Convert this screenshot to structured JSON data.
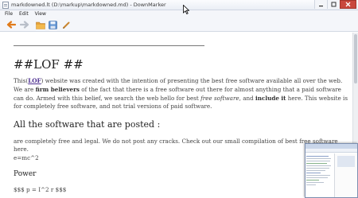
{
  "window": {
    "title": "markdowned.lt (D:\\markup\\markdowned.md) - DownMarker"
  },
  "menu": {
    "items": [
      "File",
      "Edit",
      "View"
    ]
  },
  "toolbar": {
    "buttons": [
      {
        "name": "back",
        "icon": "arrow-left-icon",
        "color": "#e07b1a"
      },
      {
        "name": "forward",
        "icon": "arrow-right-icon",
        "color": "#b9bfc9"
      },
      {
        "name": "open",
        "icon": "folder-icon",
        "color": "#e6a43a"
      },
      {
        "name": "save",
        "icon": "save-icon",
        "color": "#5a8fd0"
      },
      {
        "name": "edit",
        "icon": "pencil-icon",
        "color": "#c9862f"
      }
    ]
  },
  "document": {
    "heading1": "##LOF ##",
    "para_prefix": "This(",
    "para_link": "LOF",
    "para_part1": ") website was created with the intention of presenting the best free software available all over the web. We are ",
    "para_bold1": "firm believers",
    "para_part2": " of the fact that there is a free software out there for almost anything that a paid software can do. Armed with this belief, we search the web hello for best ",
    "para_italic": "free software",
    "para_part3": ", and ",
    "para_bold2": "include it",
    "para_part4": " here. This website is for completely free software, and not trial versions of paid software.",
    "heading2": "All the software that are posted :",
    "para2": "are completely free and legal. We do not post any cracks. Check out our small compilation of best free software here.",
    "formula1": "e=mc^2",
    "heading3": "Power",
    "formula2": "$$$ p = I^2 r $$$"
  },
  "colors": {
    "accent": "#4b2c8f",
    "close_button": "#c9473d"
  }
}
